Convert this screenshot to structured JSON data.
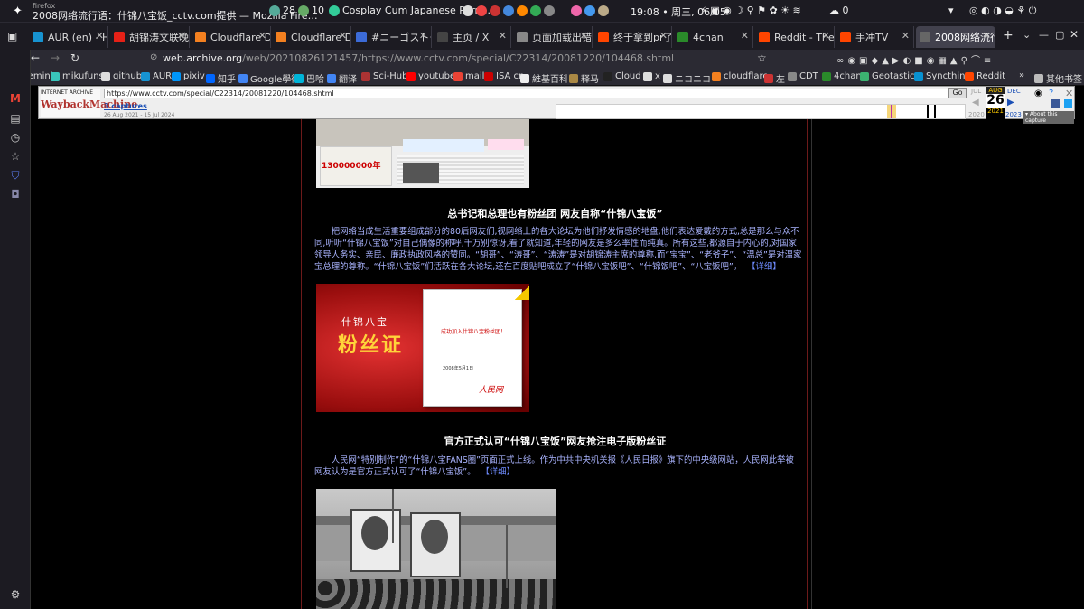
{
  "system": {
    "app_small": "firefox",
    "window_title": "2008网络流行语：什锦八宝饭_cctv.com提供 — Mozilla Fire…",
    "counter1": "28",
    "counter2": "10",
    "playing": "Cosplay Cum Japanese Porn...",
    "clock": "19:08 • 周三, 06/05",
    "notif": "0"
  },
  "tabs": [
    {
      "label": "AUR (en) - Hon",
      "color": "#1793d1"
    },
    {
      "label": "胡锦涛文联晚会",
      "color": "#e62117"
    },
    {
      "label": "Cloudflare Das",
      "color": "#f38020"
    },
    {
      "label": "Cloudflare Das",
      "color": "#f38020"
    },
    {
      "label": "#ニーゴストー",
      "color": "#3c6bd8"
    },
    {
      "label": "主页 / X",
      "color": "#444"
    },
    {
      "label": "页面加载出错",
      "color": "#888"
    },
    {
      "label": "终于拿到pr了",
      "color": "#ff4500"
    },
    {
      "label": "4chan",
      "color": "#2a8a2a"
    },
    {
      "label": "Reddit - The he",
      "color": "#ff4500"
    },
    {
      "label": "手冲TV",
      "color": "#ff4500"
    },
    {
      "label": "2008网络流行语",
      "color": "#666"
    }
  ],
  "url": {
    "host": "web.archive.org",
    "rest": "/web/20210826121457/https://www.cctv.com/special/C22314/20081220/104468.shtml"
  },
  "bookmarks": [
    {
      "label": "Gemini",
      "color": "#8ab4f8"
    },
    {
      "label": "mikufuns",
      "color": "#39c5bb"
    },
    {
      "label": "github",
      "color": "#ddd"
    },
    {
      "label": "AUR",
      "color": "#1793d1"
    },
    {
      "label": "pixiv",
      "color": "#0096fa"
    },
    {
      "label": "知乎",
      "color": "#0066ff"
    },
    {
      "label": "Google學術",
      "color": "#4285f4"
    },
    {
      "label": "巴哈",
      "color": "#00b4d8"
    },
    {
      "label": "翻译",
      "color": "#4285f4"
    },
    {
      "label": "Sci-Hub",
      "color": "#aa3333"
    },
    {
      "label": "youtube",
      "color": "#ff0000"
    },
    {
      "label": "mail",
      "color": "#ea4335"
    },
    {
      "label": "ISA cn",
      "color": "#c00"
    },
    {
      "label": "維基百科",
      "color": "#eee"
    },
    {
      "label": "释马",
      "color": "#aa8844"
    },
    {
      "label": "Cloud",
      "color": "#222"
    },
    {
      "label": "x",
      "color": "#ddd"
    },
    {
      "label": "ニコニコ",
      "color": "#ddd"
    },
    {
      "label": "cloudflare",
      "color": "#f38020"
    },
    {
      "label": "左",
      "color": "#cc3333"
    },
    {
      "label": "CDT",
      "color": "#888"
    },
    {
      "label": "4chan",
      "color": "#2a8a2a"
    },
    {
      "label": "Geotastic",
      "color": "#3cb371"
    },
    {
      "label": "Syncthing",
      "color": "#0891d1"
    },
    {
      "label": "Reddit",
      "color": "#ff4500"
    }
  ],
  "bookmarks_other": "其他书签",
  "wayback": {
    "logo_top": "INTERNET ARCHIVE",
    "logo_main": "WaybackMachine",
    "url": "https://www.cctv.com/special/C22314/20081220/104468.shtml",
    "go": "Go",
    "captures": "3 captures",
    "range": "26 Aug 2021 - 15 Jul 2024",
    "prev_month": "JUL",
    "cur_month": "AUG",
    "next_month": "DEC",
    "day": "26",
    "prev_year": "2020",
    "cur_year": "2021",
    "next_year": "2023",
    "about": "About this capture"
  },
  "article": {
    "headline1": "总书记和总理也有粉丝团 网友自称“什锦八宝饭”",
    "para1": "把网络当成生活重要组成部分的80后网友们,视网络上的各大论坛为他们抒发情感的地盘,他们表达爱戴的方式,总是那么与众不同,听听“什锦八宝饭”对自己偶像的称呼,千万别惊讶,看了就知道,年轻的网友是多么率性而纯真。所有这些,都源自于内心的,对国家领导人务实、亲民、廉政执政风格的赞同。“胡哥”、“涛哥”、“涛涛”是对胡锦涛主席的尊称,而“宝宝”、“老爷子”、“温总”是对温家宝总理的尊称。“什锦八宝饭”们活跃在各大论坛,还在百度贴吧成立了“什锦八宝饭吧”、“什锦饭吧”、“八宝饭吧”。",
    "more1": "【详细】",
    "headline2": "官方正式认可“什锦八宝饭”网友抢注电子版粉丝证",
    "para2": "人民网“特别制作”的“什锦八宝FANS圈”页面正式上线。作为中共中央机关报《人民日报》旗下的中央级网站，人民网此举被网友认为是官方正式认可了“什锦八宝饭”。",
    "more2": "【详细】",
    "cert_title1": "什锦八宝",
    "cert_title2": "粉丝证",
    "cert_text": "成功加入什锦八宝粉丝团！",
    "cert_date": "2008年5月1日",
    "cert_brand": "人民网",
    "clip_number": "130000000年"
  }
}
